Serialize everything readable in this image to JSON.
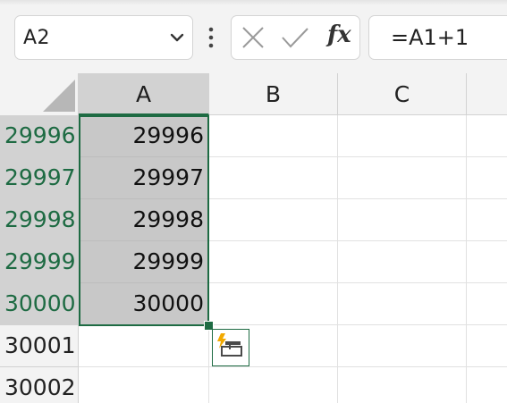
{
  "name_box": {
    "value": "A2"
  },
  "formula_bar": {
    "fx_label": "fx",
    "formula": "=A1+1"
  },
  "columns": [
    {
      "label": "A",
      "selected": true
    },
    {
      "label": "B",
      "selected": false
    },
    {
      "label": "C",
      "selected": false
    }
  ],
  "rows": [
    {
      "header": "29996",
      "cells": [
        "29996",
        "",
        "",
        ""
      ],
      "selected": true
    },
    {
      "header": "29997",
      "cells": [
        "29997",
        "",
        "",
        ""
      ],
      "selected": true
    },
    {
      "header": "29998",
      "cells": [
        "29998",
        "",
        "",
        ""
      ],
      "selected": true
    },
    {
      "header": "29999",
      "cells": [
        "29999",
        "",
        "",
        ""
      ],
      "selected": true
    },
    {
      "header": "30000",
      "cells": [
        "30000",
        "",
        "",
        ""
      ],
      "selected": true
    },
    {
      "header": "30001",
      "cells": [
        "",
        "",
        "",
        ""
      ],
      "selected": false
    },
    {
      "header": "30002",
      "cells": [
        "",
        "",
        "",
        ""
      ],
      "selected": false
    }
  ],
  "icons": {
    "name_box_dropdown": "chevron-down-icon",
    "more_options": "vertical-dots-icon",
    "cancel": "close-icon",
    "enter": "checkmark-icon",
    "quick_analysis": "flash-fill-options-icon"
  },
  "colors": {
    "accent": "#1e6b43",
    "selection_fill": "#c8c8c8",
    "header_selected": "#d2d2d2",
    "flash": "#f2a900"
  }
}
